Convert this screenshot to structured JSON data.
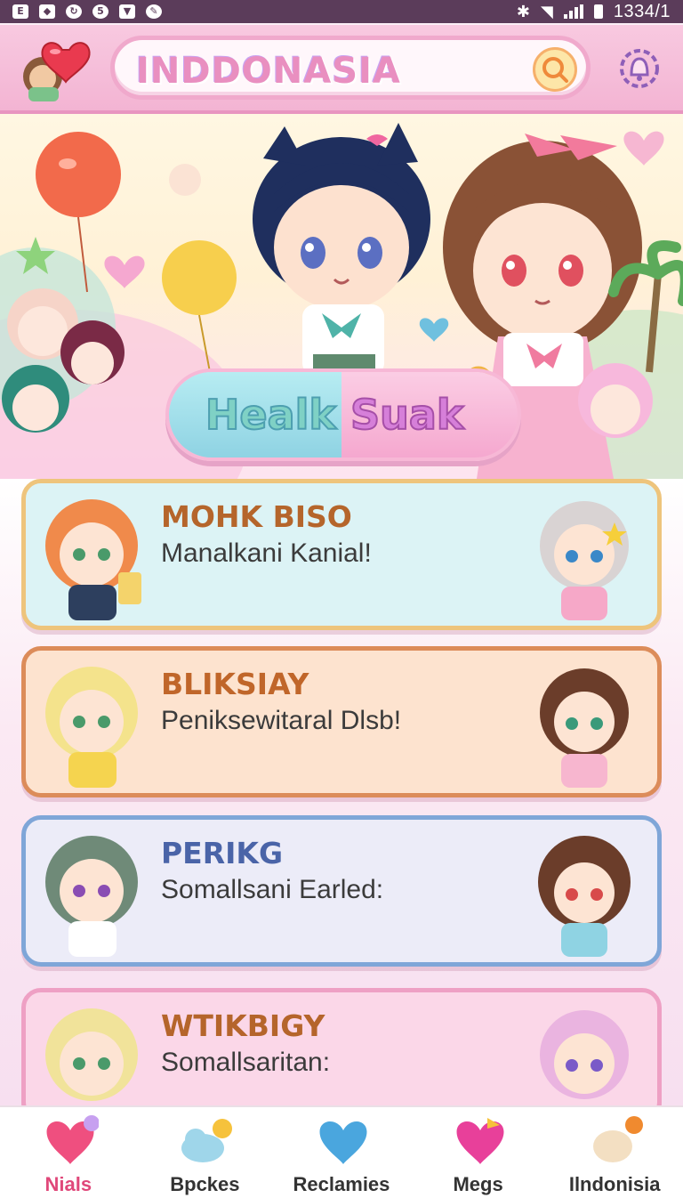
{
  "status_bar": {
    "time": "1334/1"
  },
  "header": {
    "search_text": "INDDONASIA",
    "search_icon": "magnifier-icon",
    "settings_icon": "bell-gear-icon",
    "logo_icon": "heart-logo-icon"
  },
  "hero": {
    "button_left": "Healk",
    "button_right": "Suak"
  },
  "cards": [
    {
      "title": "MOHK BISO",
      "subtitle": "Manalkani Kanial!",
      "title_color": "#b5652b",
      "bg": "#dcf3f5",
      "border": "#eec47c"
    },
    {
      "title": "BLIKSIAY",
      "subtitle": "Peniksewitaral Dlsb!",
      "title_color": "#c0662a",
      "bg": "#fde3cf",
      "border": "#dc8c5a"
    },
    {
      "title": "PERIKG",
      "subtitle": "Somallsani Earled:",
      "title_color": "#4a64a8",
      "bg": "#ececf8",
      "border": "#7fa6d8"
    },
    {
      "title": "WTIKBIGY",
      "subtitle": "Somallsaritan:",
      "title_color": "#b5652b",
      "bg": "#fbd7e8",
      "border": "#eea0c4"
    }
  ],
  "nav": [
    {
      "label": "Nials",
      "icon": "heart-icon",
      "active": true
    },
    {
      "label": "Bpckes",
      "icon": "cloud-smile-icon",
      "active": false
    },
    {
      "label": "Reclamies",
      "icon": "blue-heart-icon",
      "active": false
    },
    {
      "label": "Megs",
      "icon": "bow-heart-icon",
      "active": false
    },
    {
      "label": "Ilndonisia",
      "icon": "star-buddy-icon",
      "active": false
    }
  ],
  "colors": {
    "accent": "#e0487a",
    "header_pink": "#f3b4d3",
    "status_bar": "#5b3c5a"
  }
}
